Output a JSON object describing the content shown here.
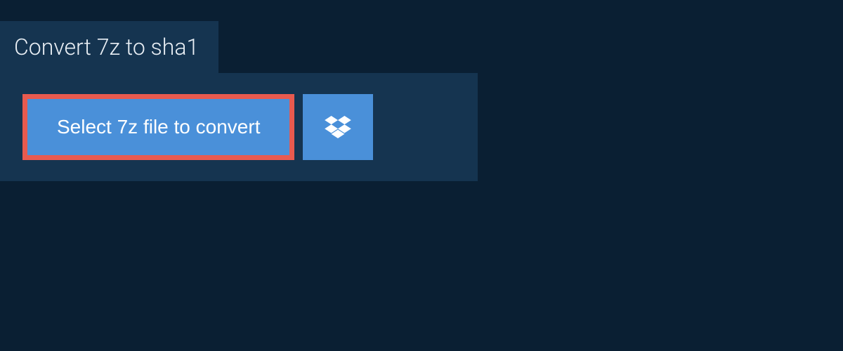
{
  "tab": {
    "title": "Convert 7z to sha1"
  },
  "actions": {
    "select_file_label": "Select 7z file to convert"
  },
  "colors": {
    "background": "#0a1f33",
    "panel": "#153450",
    "button": "#4a90d9",
    "highlight_border": "#e85a4f",
    "text_light": "#e8eef4",
    "text_white": "#ffffff"
  }
}
